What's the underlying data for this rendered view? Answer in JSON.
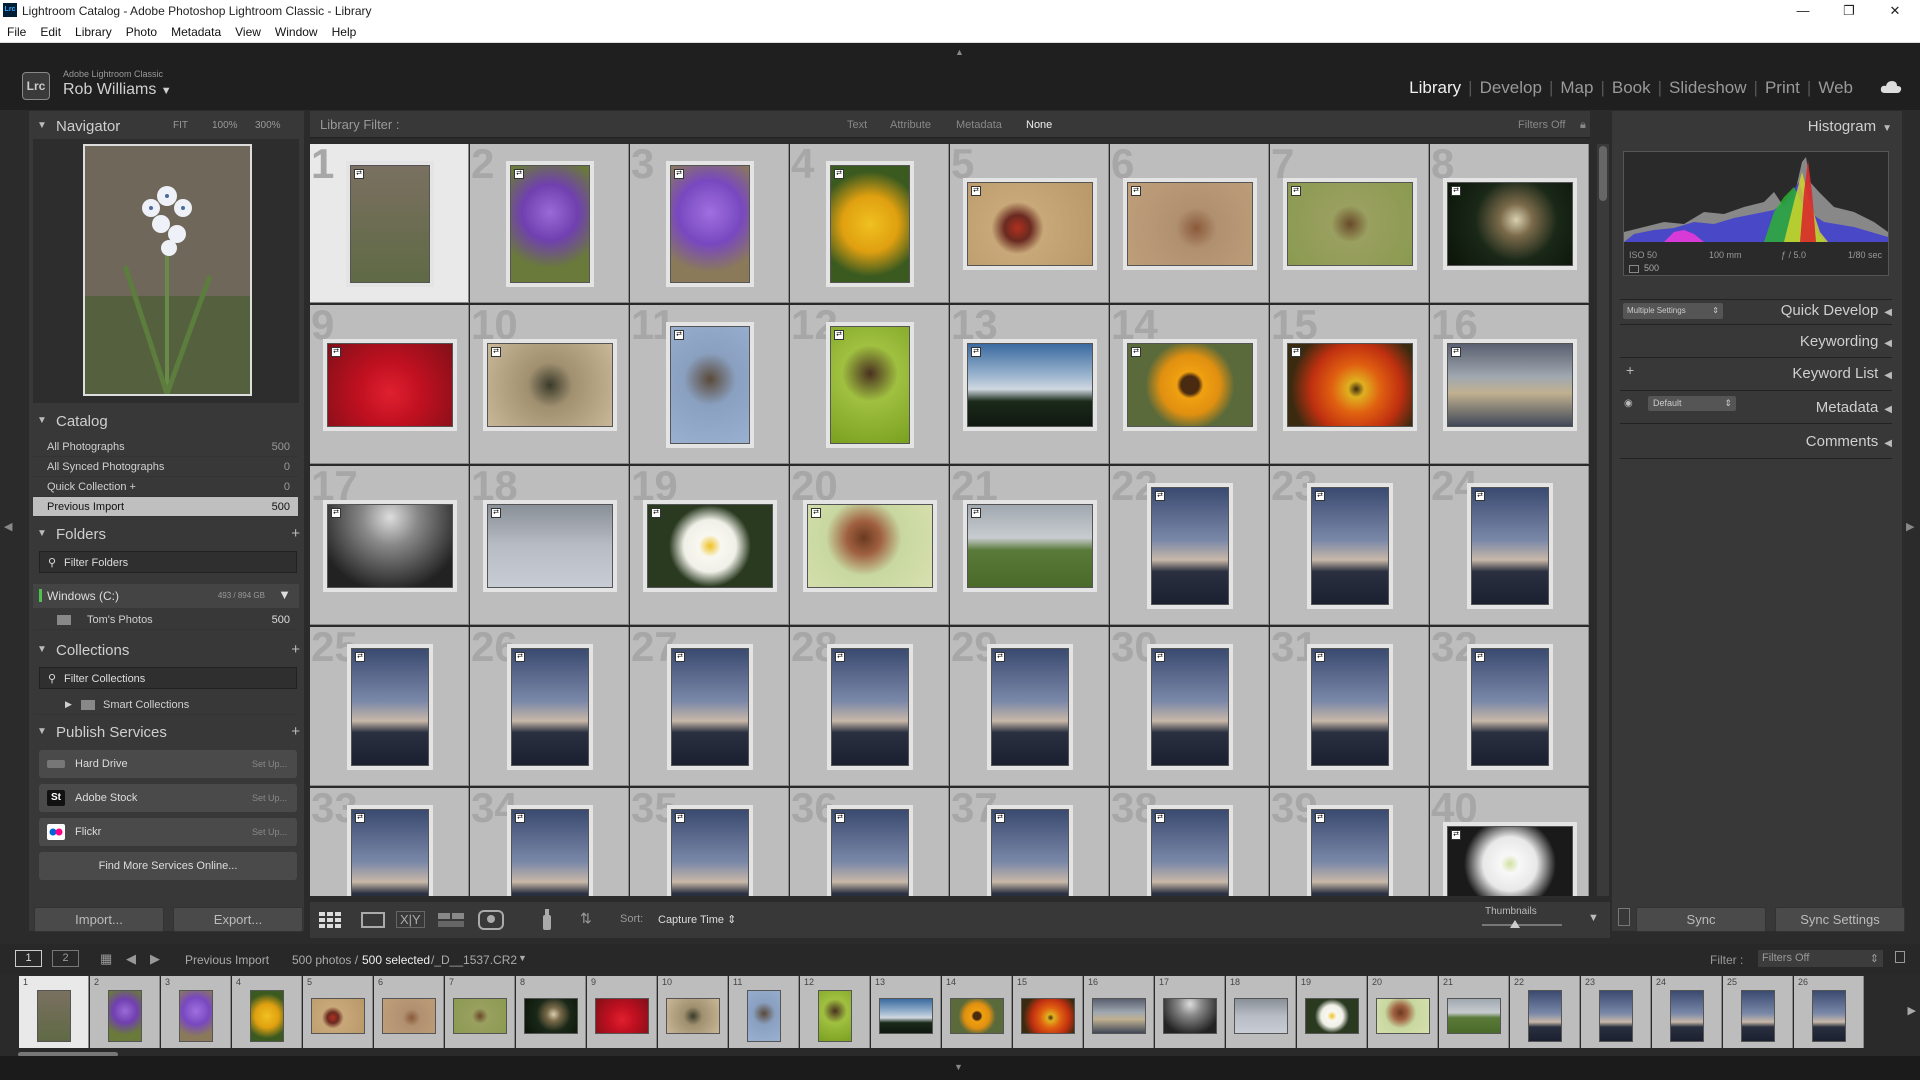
{
  "window": {
    "title": "Lightroom Catalog - Adobe Photoshop Lightroom Classic - Library",
    "icon_label": "Lrc",
    "controls": [
      "minimize-icon",
      "restore-icon",
      "close-icon"
    ]
  },
  "menu": [
    "File",
    "Edit",
    "Library",
    "Photo",
    "Metadata",
    "View",
    "Window",
    "Help"
  ],
  "identity": {
    "brand": "Adobe Lightroom Classic",
    "user": "Rob Williams",
    "badge": "Lrc"
  },
  "modules": [
    "Library",
    "Develop",
    "Map",
    "Book",
    "Slideshow",
    "Print",
    "Web"
  ],
  "active_module": "Library",
  "left": {
    "navigator": {
      "title": "Navigator",
      "zoom": [
        "FIT",
        "100%",
        "300%"
      ]
    },
    "catalog": {
      "title": "Catalog",
      "items": [
        {
          "name": "All Photographs",
          "count": "500"
        },
        {
          "name": "All Synced Photographs",
          "count": "0"
        },
        {
          "name": "Quick Collection +",
          "count": "0"
        },
        {
          "name": "Previous Import",
          "count": "500"
        }
      ]
    },
    "folders": {
      "title": "Folders",
      "filter": "Filter Folders",
      "volume": "Windows (C:)",
      "volume_size": "493 / 894 GB",
      "folder": {
        "name": "Tom's Photos",
        "count": "500"
      }
    },
    "collections": {
      "title": "Collections",
      "filter": "Filter Collections",
      "smart": "Smart Collections"
    },
    "publish": {
      "title": "Publish Services",
      "services": [
        {
          "name": "Hard Drive",
          "action": "Set Up..."
        },
        {
          "name": "Adobe Stock",
          "action": "Set Up..."
        },
        {
          "name": "Flickr",
          "action": "Set Up..."
        }
      ],
      "find_more": "Find More Services Online..."
    },
    "import": "Import...",
    "export": "Export..."
  },
  "library_filter": {
    "label": "Library Filter :",
    "options": [
      "Text",
      "Attribute",
      "Metadata",
      "None"
    ],
    "selected": "None",
    "preset": "Filters Off"
  },
  "grid": {
    "numbers": [
      "1",
      "2",
      "3",
      "4",
      "5",
      "6",
      "7",
      "8",
      "9",
      "10",
      "11",
      "12",
      "13",
      "14",
      "15",
      "16",
      "17",
      "18",
      "19",
      "20",
      "21",
      "22",
      "23",
      "24",
      "25",
      "26",
      "27",
      "28",
      "29",
      "30",
      "31",
      "32",
      "33",
      "34",
      "35",
      "36",
      "37",
      "38",
      "39",
      "40"
    ]
  },
  "toolbar": {
    "sort_label": "Sort:",
    "sort_value": "Capture Time",
    "thumbnails": "Thumbnails"
  },
  "right": {
    "histogram": {
      "title": "Histogram",
      "iso": "ISO 50",
      "focal": "100 mm",
      "aperture": "ƒ / 5.0",
      "shutter": "1/80 sec",
      "count": "500"
    },
    "quick_develop": {
      "title": "Quick Develop",
      "preset": "Multiple Settings"
    },
    "keywording": "Keywording",
    "keyword_list": "Keyword List",
    "metadata": {
      "title": "Metadata",
      "preset": "Default"
    },
    "comments": "Comments",
    "sync": "Sync",
    "sync_settings": "Sync Settings"
  },
  "filmstrip_bar": {
    "screens": [
      "1",
      "2"
    ],
    "source": "Previous Import",
    "count": "500 photos /",
    "selected": "500 selected",
    "file": "/_D__1537.CR2",
    "filter_label": "Filter :",
    "filter_value": "Filters Off"
  },
  "filmstrip": {
    "numbers": [
      "1",
      "2",
      "3",
      "4",
      "5",
      "6",
      "7",
      "8",
      "9",
      "10",
      "11",
      "12",
      "13",
      "14",
      "15",
      "16",
      "17",
      "18",
      "19",
      "20",
      "21",
      "22",
      "23",
      "24",
      "25",
      "26"
    ]
  }
}
